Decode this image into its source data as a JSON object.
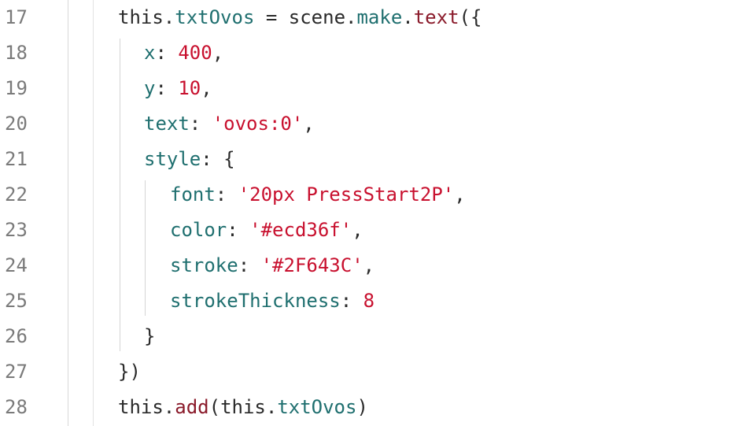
{
  "editor": {
    "lines": [
      {
        "num": "17",
        "indent": 0,
        "tokens": [
          {
            "t": "this",
            "c": "kw"
          },
          {
            "t": ".",
            "c": "plain"
          },
          {
            "t": "txtOvos",
            "c": "prop"
          },
          {
            "t": " = ",
            "c": "plain"
          },
          {
            "t": "scene",
            "c": "plain"
          },
          {
            "t": ".",
            "c": "plain"
          },
          {
            "t": "make",
            "c": "prop"
          },
          {
            "t": ".",
            "c": "plain"
          },
          {
            "t": "text",
            "c": "fn"
          },
          {
            "t": "({",
            "c": "plain"
          }
        ]
      },
      {
        "num": "18",
        "indent": 1,
        "tokens": [
          {
            "t": "x",
            "c": "prop"
          },
          {
            "t": ": ",
            "c": "plain"
          },
          {
            "t": "400",
            "c": "num"
          },
          {
            "t": ",",
            "c": "plain"
          }
        ]
      },
      {
        "num": "19",
        "indent": 1,
        "tokens": [
          {
            "t": "y",
            "c": "prop"
          },
          {
            "t": ": ",
            "c": "plain"
          },
          {
            "t": "10",
            "c": "num"
          },
          {
            "t": ",",
            "c": "plain"
          }
        ]
      },
      {
        "num": "20",
        "indent": 1,
        "tokens": [
          {
            "t": "text",
            "c": "prop"
          },
          {
            "t": ": ",
            "c": "plain"
          },
          {
            "t": "'ovos:0'",
            "c": "str"
          },
          {
            "t": ",",
            "c": "plain"
          }
        ]
      },
      {
        "num": "21",
        "indent": 1,
        "tokens": [
          {
            "t": "style",
            "c": "prop"
          },
          {
            "t": ": {",
            "c": "plain"
          }
        ]
      },
      {
        "num": "22",
        "indent": 2,
        "tokens": [
          {
            "t": "font",
            "c": "prop"
          },
          {
            "t": ": ",
            "c": "plain"
          },
          {
            "t": "'20px PressStart2P'",
            "c": "str"
          },
          {
            "t": ",",
            "c": "plain"
          }
        ]
      },
      {
        "num": "23",
        "indent": 2,
        "tokens": [
          {
            "t": "color",
            "c": "prop"
          },
          {
            "t": ": ",
            "c": "plain"
          },
          {
            "t": "'#ecd36f'",
            "c": "str"
          },
          {
            "t": ",",
            "c": "plain"
          }
        ]
      },
      {
        "num": "24",
        "indent": 2,
        "tokens": [
          {
            "t": "stroke",
            "c": "prop"
          },
          {
            "t": ": ",
            "c": "plain"
          },
          {
            "t": "'#2F643C'",
            "c": "str"
          },
          {
            "t": ",",
            "c": "plain"
          }
        ]
      },
      {
        "num": "25",
        "indent": 2,
        "tokens": [
          {
            "t": "strokeThickness",
            "c": "prop"
          },
          {
            "t": ": ",
            "c": "plain"
          },
          {
            "t": "8",
            "c": "num"
          }
        ]
      },
      {
        "num": "26",
        "indent": 1,
        "tokens": [
          {
            "t": "}",
            "c": "plain"
          }
        ]
      },
      {
        "num": "27",
        "indent": 0,
        "tokens": [
          {
            "t": "})",
            "c": "plain"
          }
        ]
      },
      {
        "num": "28",
        "indent": 0,
        "tokens": [
          {
            "t": "this",
            "c": "kw"
          },
          {
            "t": ".",
            "c": "plain"
          },
          {
            "t": "add",
            "c": "fn"
          },
          {
            "t": "(",
            "c": "plain"
          },
          {
            "t": "this",
            "c": "kw"
          },
          {
            "t": ".",
            "c": "plain"
          },
          {
            "t": "txtOvos",
            "c": "prop"
          },
          {
            "t": ")",
            "c": "plain"
          }
        ]
      }
    ]
  },
  "colors": {
    "background": "#ffffff",
    "line_number": "#7a7a7a",
    "property": "#1f6f6f",
    "function": "#8a1a2a",
    "literal": "#c8102e",
    "plain": "#2a2a2a"
  }
}
